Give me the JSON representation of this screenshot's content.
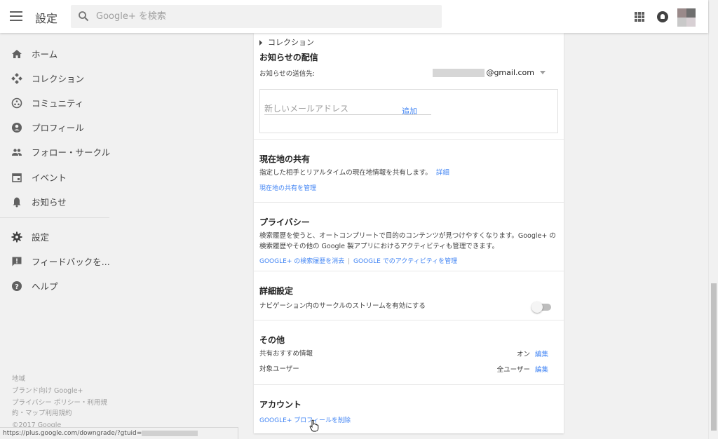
{
  "header": {
    "title": "設定",
    "search_placeholder": "Google+ を検索"
  },
  "sidebar": {
    "items": [
      {
        "label": "ホーム",
        "icon": "home-icon"
      },
      {
        "label": "コレクション",
        "icon": "collections-icon"
      },
      {
        "label": "コミュニティ",
        "icon": "communities-icon"
      },
      {
        "label": "プロフィール",
        "icon": "profile-icon"
      },
      {
        "label": "フォロー・サークル",
        "icon": "people-icon"
      },
      {
        "label": "イベント",
        "icon": "calendar-icon"
      },
      {
        "label": "お知らせ",
        "icon": "bell-icon"
      },
      {
        "label": "設定",
        "icon": "gear-icon"
      },
      {
        "label": "フィードバックを...",
        "icon": "feedback-icon"
      },
      {
        "label": "ヘルプ",
        "icon": "help-icon"
      }
    ],
    "footer": {
      "region": "地域",
      "brand": "ブランド向け Google+",
      "policy": "プライバシー ポリシー・利用規約・マップ利用規約",
      "copyright": "©2017 Google"
    }
  },
  "status_bar": {
    "url": "https://plus.google.com/downgrade/?gtuid="
  },
  "settings": {
    "collections_row": "コレクション",
    "notifications": {
      "title": "お知らせの配信",
      "send_to_label": "お知らせの送信先:",
      "email_suffix": "@gmail.com",
      "new_email_placeholder": "新しいメールアドレス",
      "add_label": "追加"
    },
    "location": {
      "title": "現在地の共有",
      "description": "指定した相手とリアルタイムの現在地情報を共有します。",
      "details_link": "詳細",
      "manage_link": "現在地の共有を管理"
    },
    "privacy": {
      "title": "プライバシー",
      "description_line1": "検索履歴を使うと、オートコンプリートで目的のコンテンツが見つけやすくなります。Google+ の",
      "description_line2": "検索履歴やその他の Google 製アプリにおけるアクティビティも管理できます。",
      "clear_history_link": "GOOGLE+ の検索履歴を消去",
      "separator": "|",
      "manage_activity_link": "GOOGLE でのアクティビティを管理"
    },
    "advanced": {
      "title": "詳細設定",
      "nav_stream_label": "ナビゲーション内のサークルのストリームを有効にする",
      "nav_stream_enabled": false
    },
    "other": {
      "title": "その他",
      "shared_endorsements_label": "共有おすすめ情報",
      "shared_endorsements_value": "オン",
      "target_users_label": "対象ユーザー",
      "target_users_value": "全ユーザー",
      "edit_label": "編集"
    },
    "account": {
      "title": "アカウント",
      "delete_profile_link": "GOOGLE+ プロフィールを削除"
    }
  },
  "colors": {
    "link": "#4285f4",
    "background": "#f1f1f1",
    "card": "#ffffff"
  }
}
